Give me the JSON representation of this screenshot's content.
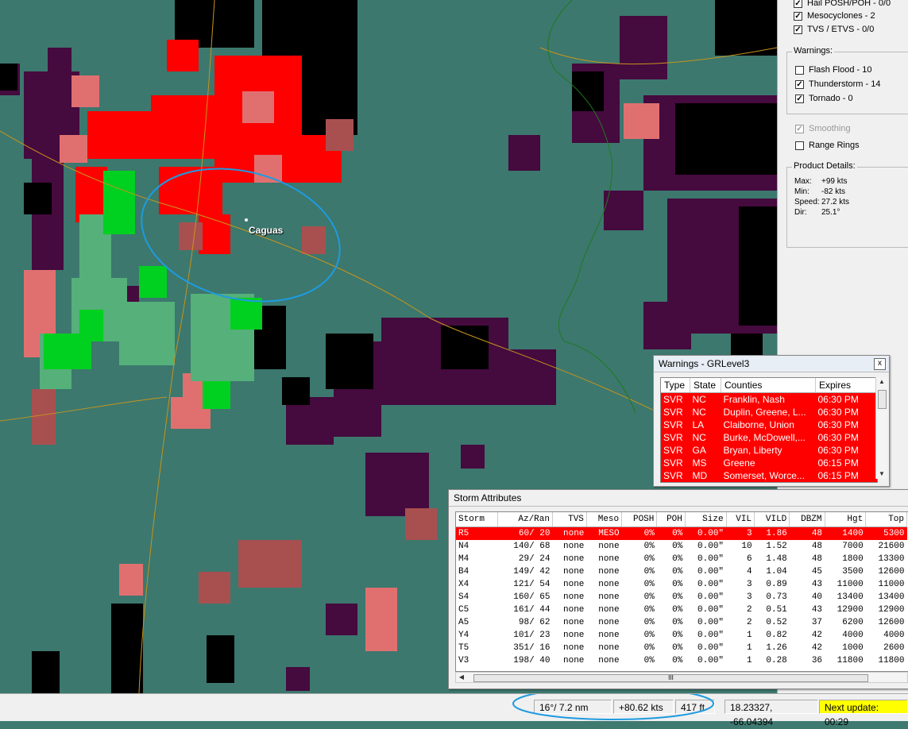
{
  "map": {
    "city": "Caguas"
  },
  "sidebar": {
    "storm_items": [
      {
        "label": "Hail POSH/POH - 0/0",
        "checked": true
      },
      {
        "label": "Mesocyclones - 2",
        "checked": true
      },
      {
        "label": "TVS / ETVS - 0/0",
        "checked": true
      }
    ],
    "warnings_title": "Warnings:",
    "warning_items": [
      {
        "label": "Flash Flood - 10",
        "checked": false
      },
      {
        "label": "Thunderstorm - 14",
        "checked": true
      },
      {
        "label": "Tornado - 0",
        "checked": true
      }
    ],
    "smoothing": "Smoothing",
    "range_rings": "Range Rings",
    "product_title": "Product Details:",
    "product": [
      {
        "key": "Max:",
        "val": "+99 kts"
      },
      {
        "key": "Min:",
        "val": "-82 kts"
      },
      {
        "key": "Speed:",
        "val": "27.2 kts"
      },
      {
        "key": "Dir:",
        "val": "25.1°"
      }
    ]
  },
  "warnings_window": {
    "title": "Warnings - GRLevel3",
    "close": "x",
    "headers": [
      "Type",
      "State",
      "Counties",
      "Expires"
    ],
    "rows": [
      [
        "SVR",
        "NC",
        "Franklin, Nash",
        "06:30 PM"
      ],
      [
        "SVR",
        "NC",
        "Duplin, Greene, L...",
        "06:30 PM"
      ],
      [
        "SVR",
        "LA",
        "Claiborne, Union",
        "06:30 PM"
      ],
      [
        "SVR",
        "NC",
        "Burke, McDowell,...",
        "06:30 PM"
      ],
      [
        "SVR",
        "GA",
        "Bryan, Liberty",
        "06:30 PM"
      ],
      [
        "SVR",
        "MS",
        "Greene",
        "06:15 PM"
      ],
      [
        "SVR",
        "MD",
        "Somerset, Worce...",
        "06:15 PM"
      ]
    ]
  },
  "storm_window": {
    "title": "Storm Attributes",
    "headers": [
      "Storm",
      "Az/Ran",
      "TVS",
      "Meso",
      "POSH",
      "POH",
      "Size",
      "VIL",
      "VILD",
      "DBZM",
      "Hgt",
      "Top"
    ],
    "rows": [
      [
        "R5",
        "60/ 20",
        "none",
        "MESO",
        "0%",
        "0%",
        "0.00\"",
        "3",
        "1.86",
        "48",
        "1400",
        "5300"
      ],
      [
        "N4",
        "140/ 68",
        "none",
        "none",
        "0%",
        "0%",
        "0.00\"",
        "10",
        "1.52",
        "48",
        "7000",
        "21600"
      ],
      [
        "M4",
        "29/ 24",
        "none",
        "none",
        "0%",
        "0%",
        "0.00\"",
        "6",
        "1.48",
        "48",
        "1800",
        "13300"
      ],
      [
        "B4",
        "149/ 42",
        "none",
        "none",
        "0%",
        "0%",
        "0.00\"",
        "4",
        "1.04",
        "45",
        "3500",
        "12600"
      ],
      [
        "X4",
        "121/ 54",
        "none",
        "none",
        "0%",
        "0%",
        "0.00\"",
        "3",
        "0.89",
        "43",
        "11000",
        "11000"
      ],
      [
        "S4",
        "160/ 65",
        "none",
        "none",
        "0%",
        "0%",
        "0.00\"",
        "3",
        "0.73",
        "40",
        "13400",
        "13400"
      ],
      [
        "C5",
        "161/ 44",
        "none",
        "none",
        "0%",
        "0%",
        "0.00\"",
        "2",
        "0.51",
        "43",
        "12900",
        "12900"
      ],
      [
        "A5",
        "98/ 62",
        "none",
        "none",
        "0%",
        "0%",
        "0.00\"",
        "2",
        "0.52",
        "37",
        "6200",
        "12600"
      ],
      [
        "Y4",
        "101/ 23",
        "none",
        "none",
        "0%",
        "0%",
        "0.00\"",
        "1",
        "0.82",
        "42",
        "4000",
        "4000"
      ],
      [
        "T5",
        "351/ 16",
        "none",
        "none",
        "0%",
        "0%",
        "0.00\"",
        "1",
        "1.26",
        "42",
        "1000",
        "2600"
      ],
      [
        "V3",
        "198/ 40",
        "none",
        "none",
        "0%",
        "0%",
        "0.00\"",
        "1",
        "0.28",
        "36",
        "11800",
        "11800"
      ]
    ],
    "scroll_grip": "III"
  },
  "status": {
    "az_range": "16°/ 7.2 nm",
    "velocity": "+80.62 kts",
    "height": "417 ft",
    "coords": "18.23327, -66.04394",
    "next_update": "Next update: 00:29"
  }
}
